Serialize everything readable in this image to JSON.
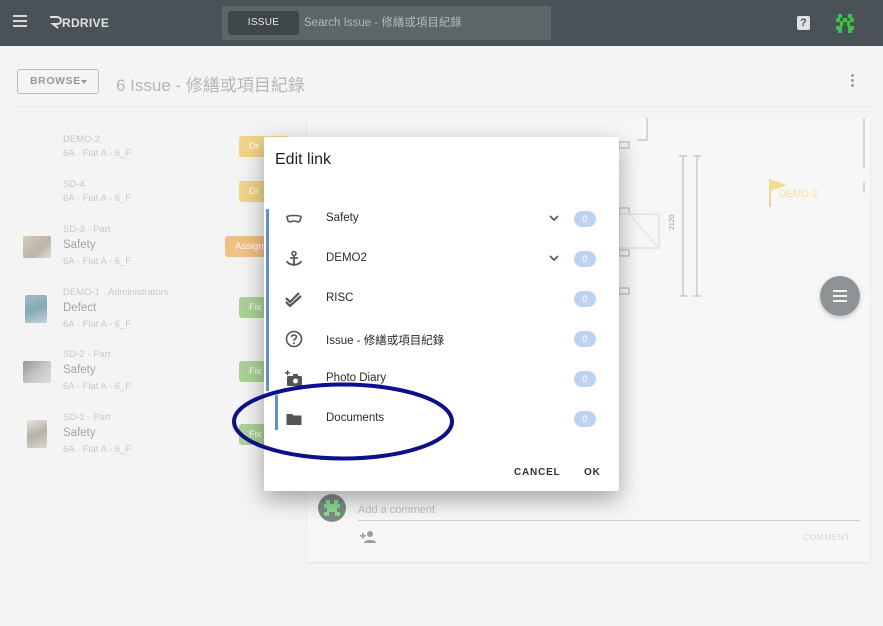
{
  "app": {
    "brand": "RDRIVE"
  },
  "search": {
    "chip": "ISSUE",
    "placeholder": "Search Issue - 修繕或項目紀錄"
  },
  "header": {
    "browse_label": "BROWSE",
    "title": "6 Issue - 修繕或項目紀錄"
  },
  "list": [
    {
      "sub": "DEMO-2",
      "title": "",
      "loc": "6A · Flat A - 6_F",
      "badge": "Dr",
      "badge_color": "#e8b632",
      "thumb": false
    },
    {
      "sub": "SD-4",
      "title": "",
      "loc": "6A · Flat A - 6_F",
      "badge": "Dr",
      "badge_color": "#e8b632",
      "thumb": false
    },
    {
      "sub": "SD-3 · Part",
      "title": "Safety",
      "loc": "6A · Flat A - 6_F",
      "badge": "Assign",
      "badge_color": "#e8922c",
      "thumb": true
    },
    {
      "sub": "DEMO-1 · Administrators",
      "title": "Defect",
      "loc": "6A · Flat A - 6_F",
      "badge": "Fix",
      "badge_color": "#6fb24b",
      "thumb": true
    },
    {
      "sub": "SD-2 · Part",
      "title": "Safety",
      "loc": "6A · Flat A - 6_F",
      "badge": "Fix",
      "badge_color": "#6fb24b",
      "thumb": true
    },
    {
      "sub": "SD-1 · Part",
      "title": "Safety",
      "loc": "6A · Flat A - 6_F",
      "badge": "Fix",
      "badge_color": "#6fb24b",
      "thumb": true
    }
  ],
  "drawing": {
    "dimension": "2120",
    "flag_label": "DEMO-2"
  },
  "comment": {
    "placeholder": "Add a comment",
    "button": "COMMENT"
  },
  "dialog": {
    "title": "Edit link",
    "rows": [
      {
        "label": "Safety",
        "count": "0",
        "icon": "visor-icon",
        "expandable": true
      },
      {
        "label": "DEMO2",
        "count": "0",
        "icon": "anchor-icon",
        "expandable": true
      },
      {
        "label": "RISC",
        "count": "0",
        "icon": "double-check-icon",
        "expandable": false
      },
      {
        "label": "Issue - 修繕或項目紀錄",
        "count": "0",
        "icon": "help-circle-icon",
        "expandable": false
      },
      {
        "label": "Photo Diary",
        "count": "0",
        "icon": "camera-plus-icon",
        "expandable": false
      },
      {
        "label": "Documents",
        "count": "0",
        "icon": "folder-icon",
        "expandable": false
      }
    ],
    "cancel": "CANCEL",
    "ok": "OK"
  },
  "colors": {
    "topbar": "#4a5257",
    "count_badge": "#bed2f4",
    "selection_bar": "#5b8fd6",
    "annotation_ellipse": "#0d0f8c",
    "badge_draft": "#e8b632",
    "badge_assign": "#e8922c",
    "badge_fix": "#6fb24b"
  }
}
